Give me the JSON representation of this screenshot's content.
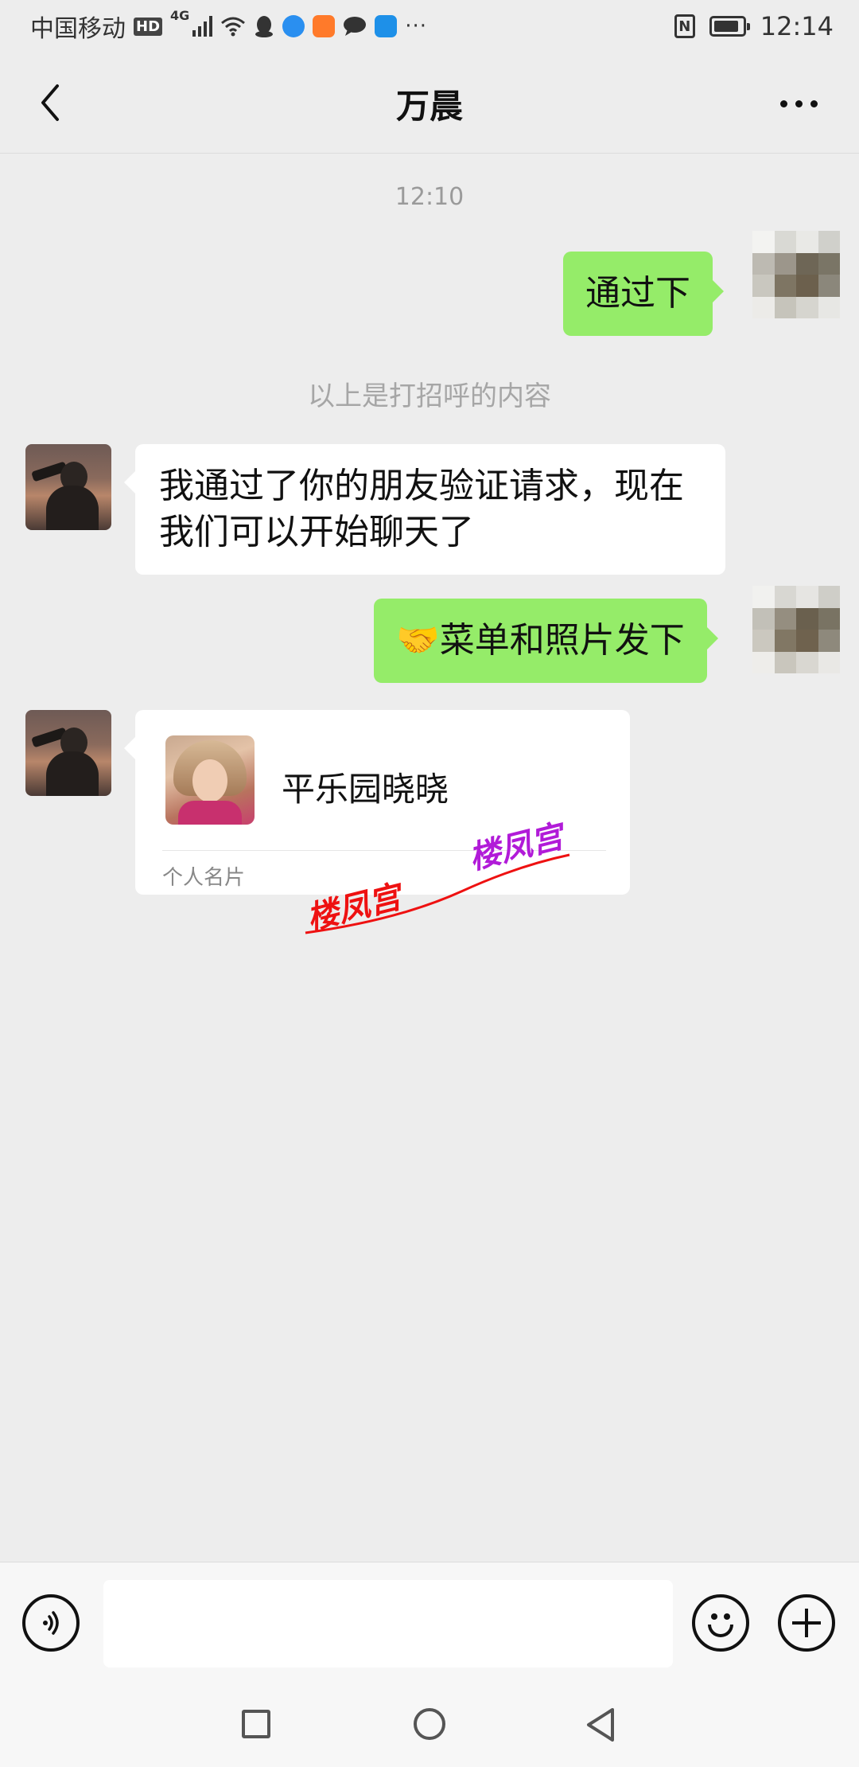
{
  "status_bar": {
    "carrier": "中国移动",
    "hd_badge": "HD",
    "network": "4G",
    "more": "···",
    "nfc": "N",
    "time": "12:14"
  },
  "header": {
    "title": "万晨"
  },
  "chat": {
    "timestamp": "12:10",
    "system_note": "以上是打招呼的内容",
    "messages": [
      {
        "side": "outgoing",
        "text": "通过下"
      },
      {
        "side": "incoming",
        "text": "我通过了你的朋友验证请求，现在我们可以开始聊天了"
      },
      {
        "side": "outgoing",
        "emoji": "🤝",
        "text": "菜单和照片发下"
      }
    ],
    "contact_card": {
      "name": "平乐园晓晓",
      "type_label": "个人名片"
    }
  },
  "watermark": {
    "text_left": "楼凤宫",
    "text_right": "楼凤宫",
    "colors": [
      "#e11111",
      "#b11bd8"
    ]
  },
  "colors": {
    "outgoing_bubble": "#95ec69",
    "incoming_bubble": "#ffffff",
    "background": "#ededed"
  }
}
